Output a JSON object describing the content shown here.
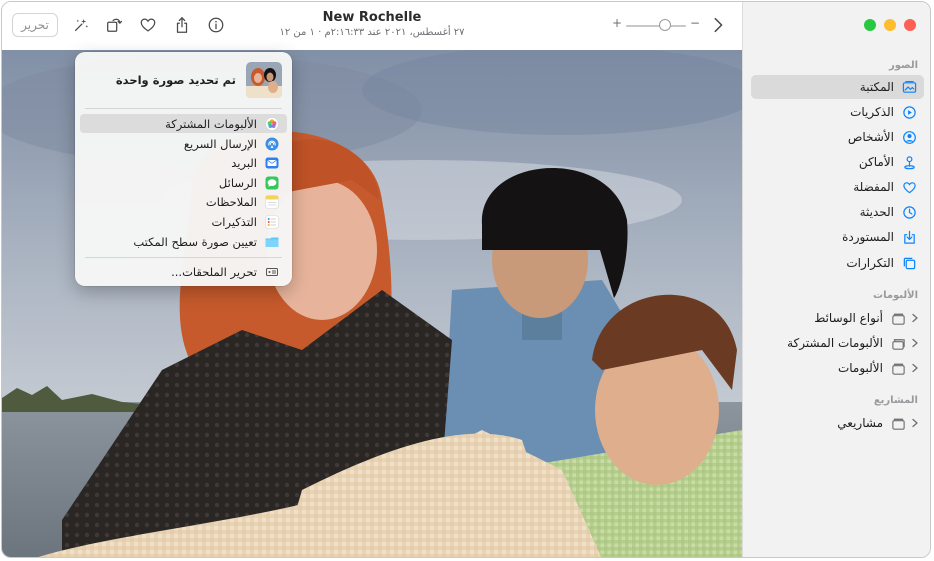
{
  "toolbar": {
    "edit_label": "تحرير",
    "title": "New Rochelle",
    "subtitle": "٢٧ أغسطس، ٢٠٢١ عند ٢:١٦:٣٣م  ·  ١ من ١٢",
    "zoom_plus": "+",
    "zoom_minus": "−",
    "zoom_level": 0.35,
    "icons": [
      "magic-wand-icon",
      "rotate-icon",
      "heart-icon",
      "share-icon",
      "info-icon",
      "chevron-right-icon"
    ]
  },
  "share_menu": {
    "header": "تم تحديد صورة واحدة",
    "items": [
      {
        "label": "الألبومات المشتركة",
        "icon": "shared-albums-icon",
        "color": "#f5a623",
        "selected": true
      },
      {
        "label": "الإرسال السريع",
        "icon": "airdrop-icon",
        "color": "#3a8ee6"
      },
      {
        "label": "البريد",
        "icon": "mail-icon",
        "color": "#2f80ed"
      },
      {
        "label": "الرسائل",
        "icon": "messages-icon",
        "color": "#34c759"
      },
      {
        "label": "الملاحظات",
        "icon": "notes-icon",
        "color": "#f7d25a"
      },
      {
        "label": "التذكيرات",
        "icon": "reminders-icon",
        "color": "#e9e9e9"
      },
      {
        "label": "تعيين صورة سطح المكتب",
        "icon": "desktop-picture-icon",
        "color": "#5ac8fa"
      }
    ],
    "footer": "تحرير الملحقات..."
  },
  "sidebar": {
    "traffic_lights": [
      "#fd5f57",
      "#febc2e",
      "#28c840"
    ],
    "photos_header": "الصور",
    "library_items": [
      {
        "label": "المكتبة",
        "icon": "library-icon",
        "selected": true
      },
      {
        "label": "الذكريات",
        "icon": "memories-icon"
      },
      {
        "label": "الأشخاص",
        "icon": "people-icon"
      },
      {
        "label": "الأماكن",
        "icon": "places-icon"
      },
      {
        "label": "المفضلة",
        "icon": "favorites-icon"
      },
      {
        "label": "الحديثة",
        "icon": "recents-icon"
      },
      {
        "label": "المستوردة",
        "icon": "imports-icon"
      },
      {
        "label": "التكرارات",
        "icon": "duplicates-icon"
      }
    ],
    "albums_header": "الألبومات",
    "album_items": [
      {
        "label": "أنواع الوسائط",
        "icon": "folder-icon"
      },
      {
        "label": "الألبومات المشتركة",
        "icon": "shared-folder-icon"
      },
      {
        "label": "الألبومات",
        "icon": "folder-icon"
      }
    ],
    "projects_header": "المشاريع",
    "project_items": [
      {
        "label": "مشاريعي",
        "icon": "folder-icon"
      }
    ],
    "accent_color": "#0a84ff"
  }
}
